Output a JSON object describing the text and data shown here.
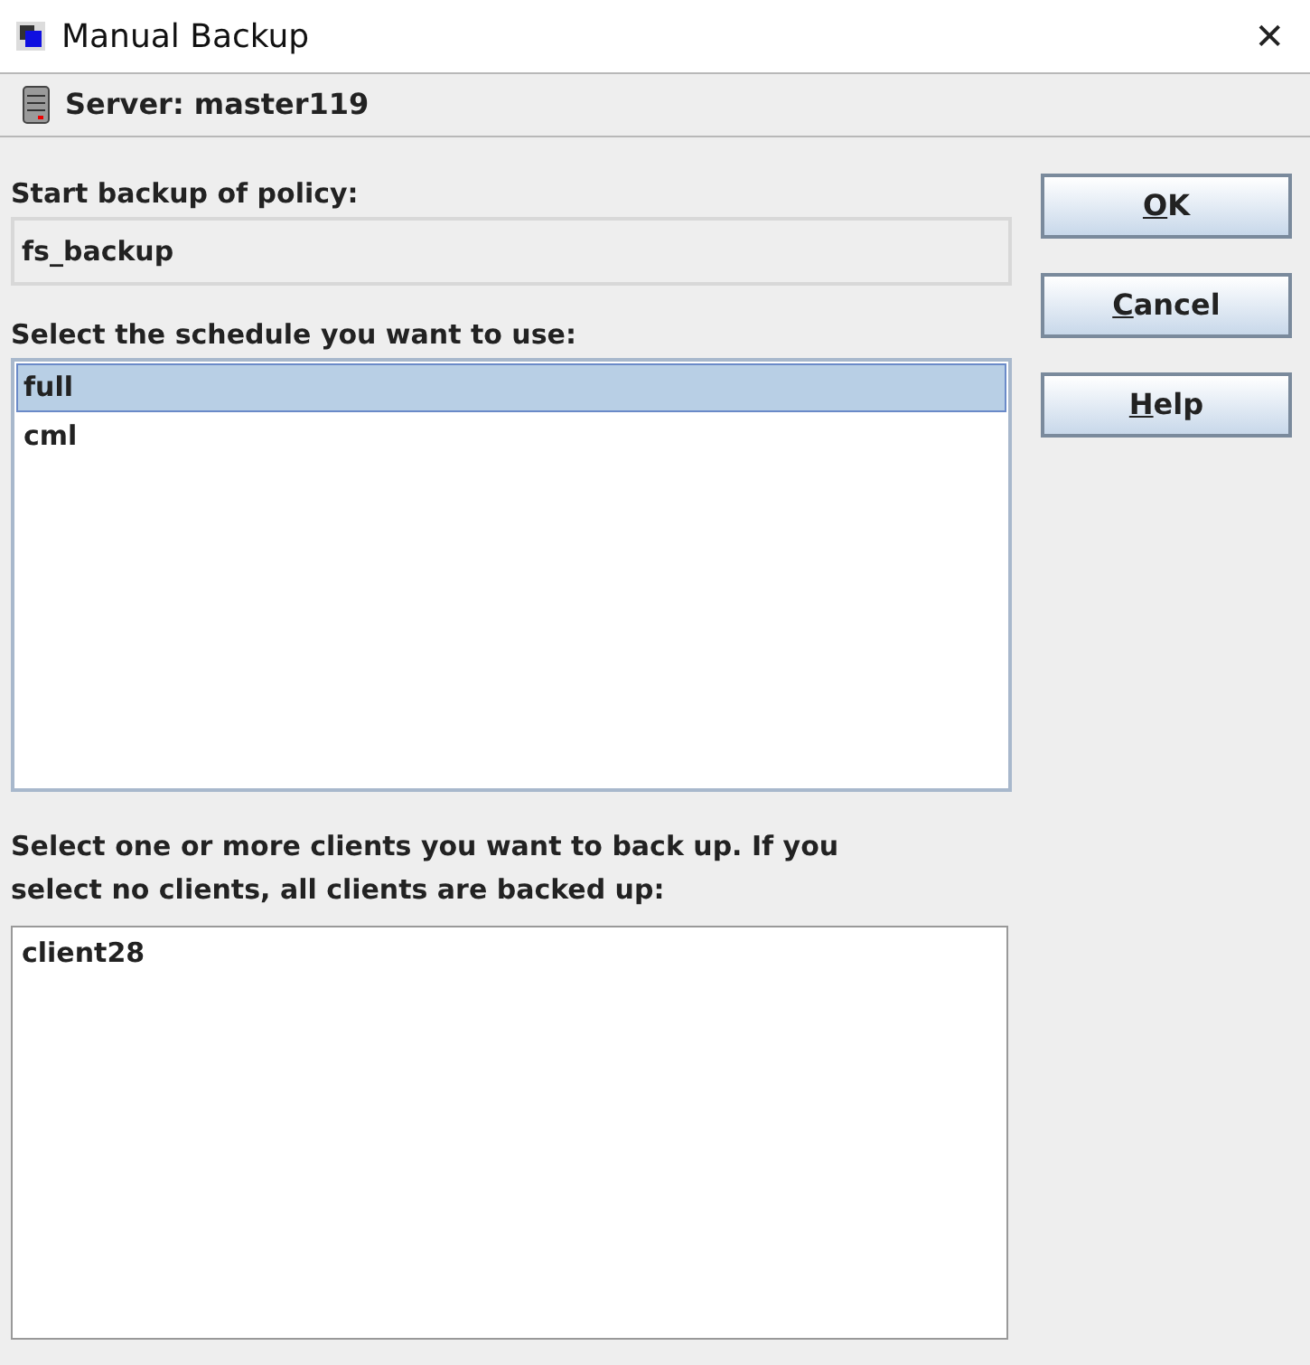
{
  "window": {
    "title": "Manual Backup",
    "close": "✕"
  },
  "server": {
    "label": "Server: master119"
  },
  "policy": {
    "label": "Start backup of policy:",
    "value": "fs_backup",
    "disabled": true
  },
  "schedules": {
    "label": "Select the schedule you want to use:",
    "items": [
      {
        "text": "full",
        "selected": true
      },
      {
        "text": "cml",
        "selected": false
      }
    ]
  },
  "clients": {
    "label": "Select one or more clients you want to back up. If you select no clients, all clients are backed up:",
    "items": [
      {
        "text": "client28",
        "selected": false
      }
    ]
  },
  "buttons": [
    {
      "label": "OK",
      "underline_first": true
    },
    {
      "label": "Cancel",
      "underline_first": true
    },
    {
      "label": "Help",
      "underline_first": true
    }
  ]
}
